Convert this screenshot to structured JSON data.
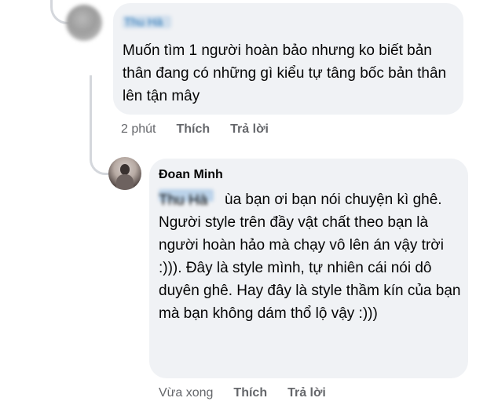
{
  "comment": {
    "author_name": "Thu Hà",
    "text": "Muốn tìm 1 người hoàn bảo nhưng ko biết bản thân đang có những gì kiểu tự tâng bốc bản thân lên tận mây",
    "timestamp": "2 phút",
    "like_label": "Thích",
    "reply_label": "Trả lời"
  },
  "reply": {
    "author_name": "Đoan Minh",
    "mention": "Thu Hà",
    "text": "ùa bạn ơi bạn nói chuyện kì ghê. Người style trên đầy vật chất theo bạn là người hoàn hảo mà chạy vô lên án vậy trời :))). Đây là style mình, tự nhiên cái nói dô duyên ghê. Hay đây là style thầm kín của bạn mà bạn không dám thổ lộ vậy :)))",
    "timestamp": "Vừa xong",
    "like_label": "Thích",
    "reply_label": "Trả lời"
  }
}
